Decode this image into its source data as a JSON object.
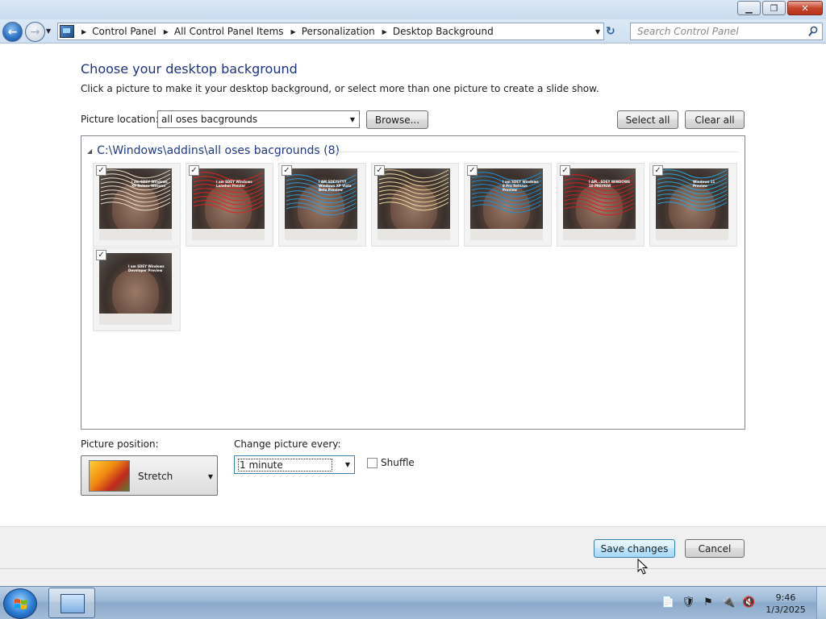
{
  "window": {
    "minimize_glyph": "▁",
    "restore_glyph": "❐",
    "close_glyph": "✕"
  },
  "nav": {
    "back_glyph": "←",
    "forward_glyph": "→",
    "recent_glyph": "▼",
    "breadcrumbs": [
      "Control Panel",
      "All Control Panel Items",
      "Personalization",
      "Desktop Background"
    ],
    "crumb_sep": "▶",
    "dropdown_glyph": "▼",
    "refresh_glyph": "↻",
    "search_placeholder": "Search Control Panel"
  },
  "page": {
    "title": "Choose your desktop background",
    "description": "Click a picture to make it your desktop background, or select more than one picture to create a slide show.",
    "location_label": "Picture location:",
    "location_value": "all oses bacgrounds",
    "browse_label": "Browse...",
    "select_all_label": "Select all",
    "clear_all_label": "Clear all"
  },
  "gallery": {
    "group_toggle": "◢",
    "group_title": "C:\\Windows\\addins\\all oses bacgrounds (8)",
    "check_glyph": "✓",
    "items": [
      {
        "name": "bg-1",
        "checked": true,
        "scribble_color": "#e7dcc8",
        "note": "I am SDEY Windows XP Relnex Weeann"
      },
      {
        "name": "bg-2",
        "checked": true,
        "scribble_color": "#e0241f",
        "note": "I am SDEY Windows Lonehor Previer"
      },
      {
        "name": "bg-3",
        "checked": true,
        "scribble_color": "#2e9ad8",
        "note": "I AM SDEYSTYY Windows XP Vista Beta Preview"
      },
      {
        "name": "bg-4",
        "checked": true,
        "scribble_color": "#eed9a0",
        "note": ""
      },
      {
        "name": "bg-5",
        "checked": true,
        "scribble_color": "#1b8fd4",
        "note": "I am SDEY Windows 8 Pro Release Preview"
      },
      {
        "name": "bg-6",
        "checked": true,
        "scribble_color": "#d61c22",
        "note": "I AM...SDEY WINDOWS 10 PREVIEW"
      },
      {
        "name": "bg-7",
        "checked": true,
        "scribble_color": "#2aa3d8",
        "note": "Windows 11 Preview"
      },
      {
        "name": "bg-8",
        "checked": true,
        "scribble_color": "",
        "note": "I am SDEY Windows Developer Preview"
      }
    ]
  },
  "options": {
    "position_label": "Picture position:",
    "position_value": "Stretch",
    "change_label": "Change picture every:",
    "interval_value": "1 minute",
    "shuffle_label": "Shuffle",
    "shuffle_checked": false,
    "dropdown_glyph": "▼"
  },
  "footer": {
    "save_label": "Save changes",
    "cancel_label": "Cancel"
  },
  "taskbar": {
    "tray_icons": [
      "📄",
      "🛡",
      "⚑",
      "🔌",
      "🔇"
    ],
    "time": "9:46",
    "date": "1/3/2025"
  }
}
